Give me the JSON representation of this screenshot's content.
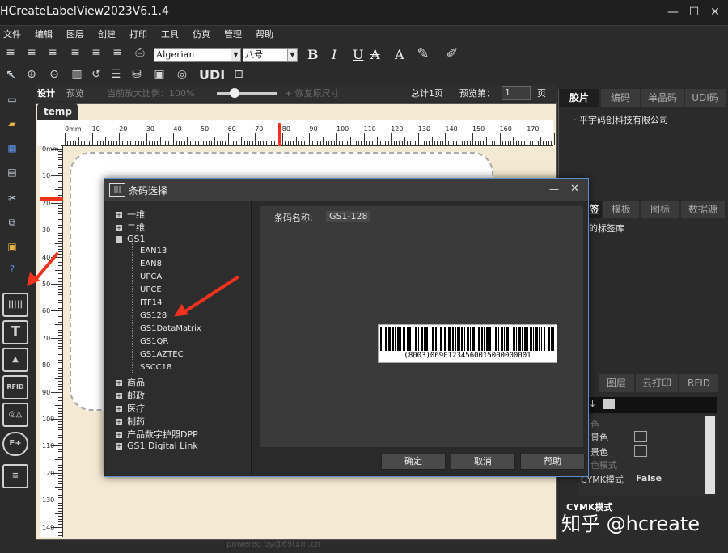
{
  "window": {
    "title": "HCreateLabelView2023V6.1.4",
    "min": "—",
    "max": "☐",
    "close": "✕"
  },
  "menu": [
    "文件",
    "编辑",
    "图层",
    "创建",
    "打印",
    "工具",
    "仿真",
    "管理",
    "帮助"
  ],
  "format_bar": {
    "font_name": "Algerian",
    "font_size": "八号",
    "bold": "B",
    "italic": "I",
    "underline": "U",
    "strike": "A",
    "color_a": "A"
  },
  "toolbar2": {
    "udi": "UDI"
  },
  "design_row": {
    "design_tab": "设计",
    "preview_tab": "预览",
    "zoom_label": "当前放大比例：100%",
    "restore_label": "恢复原尺寸",
    "total_pages": "总计1页",
    "preview_page_label": "预览第：",
    "page_number": "1",
    "page_suffix": "页"
  },
  "document": {
    "tab_name": "temp",
    "hruler_labels": [
      "0mm",
      "10",
      "20",
      "30",
      "40",
      "50",
      "60",
      "70",
      "80",
      "90",
      "100",
      "110",
      "120",
      "130",
      "140",
      "150",
      "160",
      "170"
    ],
    "vruler_labels": [
      "0mm",
      "10",
      "20",
      "30",
      "40",
      "50",
      "60",
      "70",
      "80",
      "90",
      "100",
      "110",
      "120",
      "130",
      "140"
    ],
    "watermark": "powered by@69txm.cn"
  },
  "left_toolbar": {
    "big_icons": [
      "barcode",
      "T",
      "image",
      "RFID",
      "shape",
      "F+",
      "doc"
    ],
    "rfid_text": "RFID",
    "f_text": "F+"
  },
  "right_panel_1": {
    "tabs": [
      "胶片",
      "编码",
      "单品码",
      "UDI码"
    ],
    "item": "平宇码创科技有限公司"
  },
  "right_panel_2": {
    "tabs": [
      "签",
      "模板",
      "图标",
      "数据源"
    ],
    "item": "的标签库"
  },
  "right_panel_3": {
    "tabs": [
      "图层",
      "云打印",
      "RFID"
    ],
    "props": [
      {
        "label": "色",
        "muted": true
      },
      {
        "label": "景色",
        "box": true
      },
      {
        "label": "景色",
        "box": true
      },
      {
        "label": "色模式",
        "muted": true
      },
      {
        "label": "CYMK模式",
        "value": "False"
      }
    ],
    "footer_title": "CYMK模式"
  },
  "dialog": {
    "title": "条码选择",
    "tree_top": [
      "一维",
      "二维",
      "GS1"
    ],
    "gs1_children": [
      "EAN13",
      "EAN8",
      "UPCA",
      "UPCE",
      "ITF14",
      "GS128",
      "GS1DataMatrix",
      "GS1QR",
      "GS1AZTEC",
      "SSCC18"
    ],
    "tree_bottom": [
      "商品",
      "邮政",
      "医疗",
      "制药",
      "产品数字护照DPP",
      "GS1 Digital Link"
    ],
    "barcode_name_label": "条码名称:",
    "barcode_name_value": "GS1-128",
    "barcode_digits": "(8003)06901234560015000000001",
    "buttons": {
      "ok": "确定",
      "cancel": "取消",
      "help": "帮助"
    },
    "min": "—",
    "close": "✕"
  },
  "brand_watermark": "知乎 @hcreate",
  "colors": {
    "accent_red": "#f0321e",
    "dialog_border": "#5a8fc8"
  }
}
